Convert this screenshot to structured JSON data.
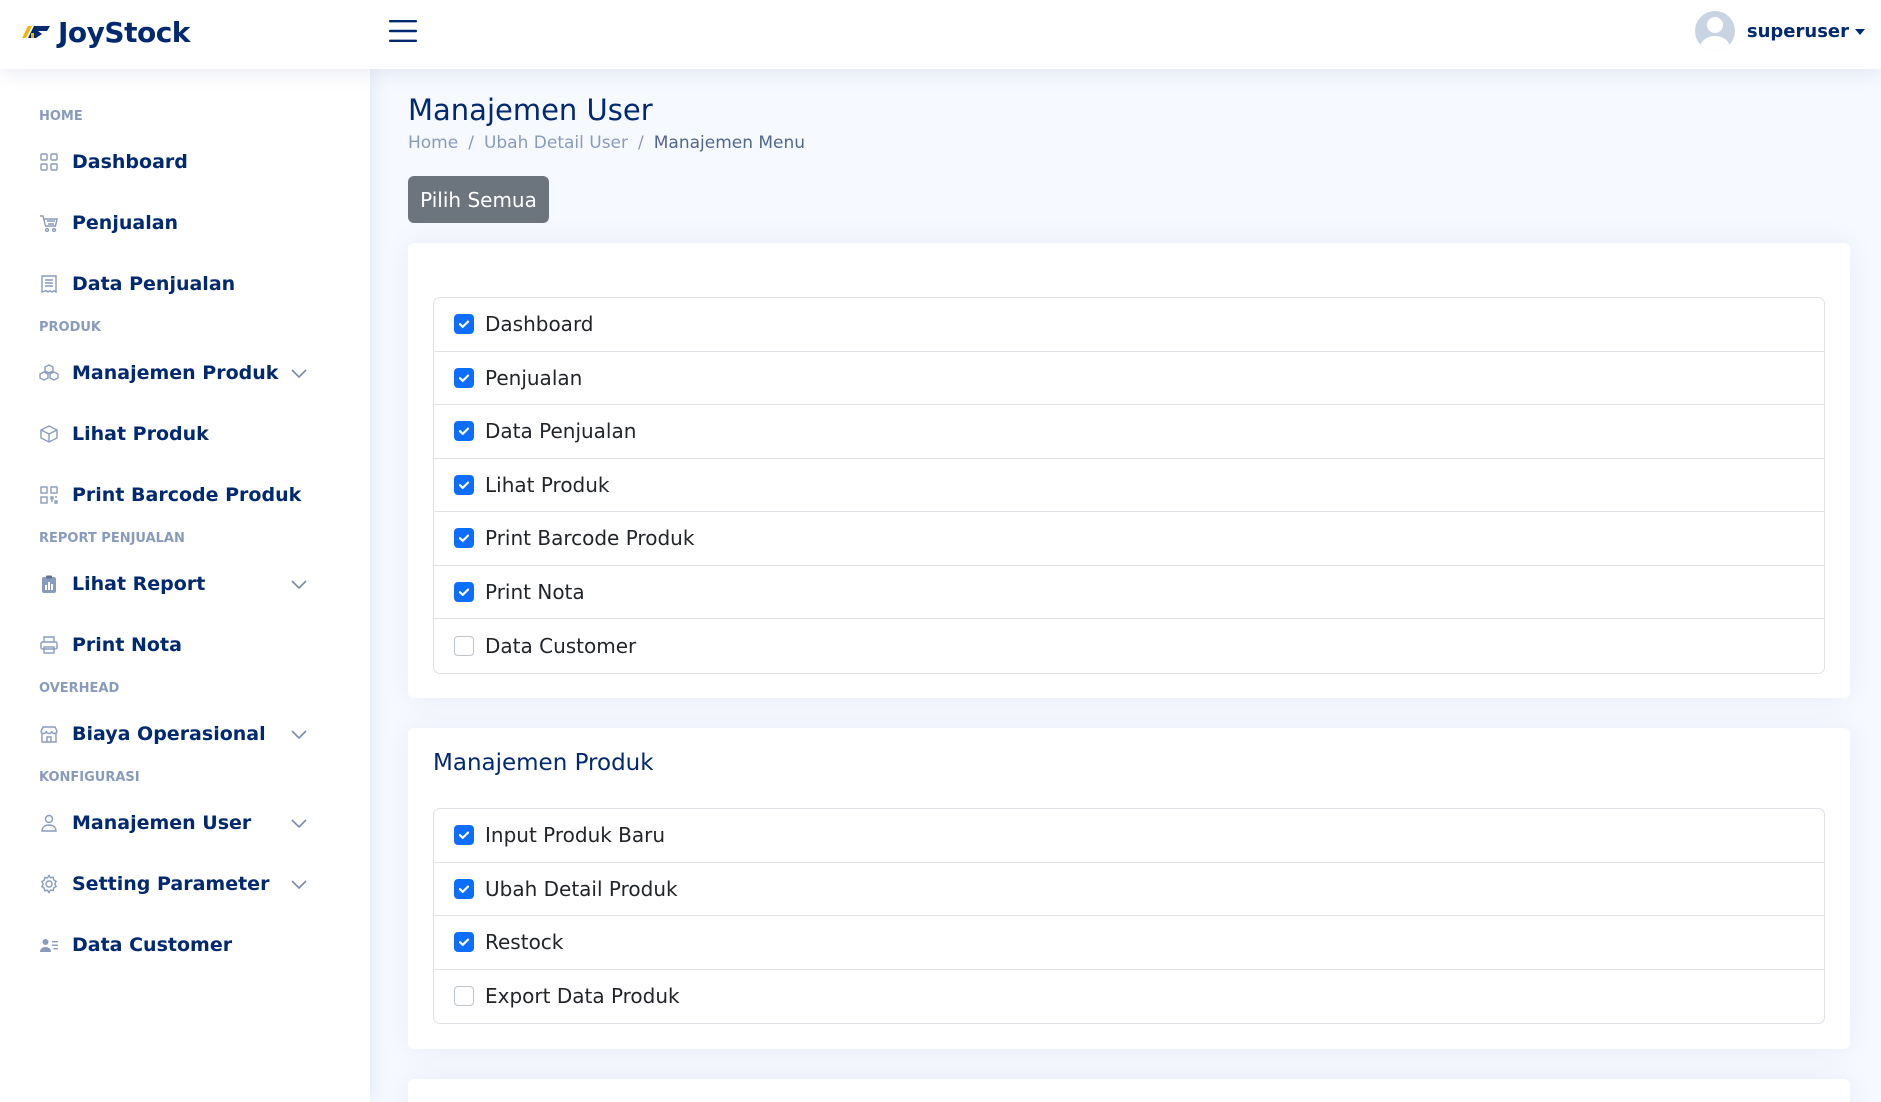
{
  "header": {
    "app_name": "JoyStock",
    "username": "superuser",
    "icons": {
      "logo": "joystock-logo-icon",
      "menu": "hamburger-menu-icon",
      "avatar": "user-avatar-icon"
    }
  },
  "sidebar": {
    "sections": [
      {
        "heading": "HOME",
        "items": [
          {
            "label": "Dashboard",
            "icon": "grid-icon",
            "expandable": false
          },
          {
            "label": "Penjualan",
            "icon": "cart-icon",
            "expandable": false
          },
          {
            "label": "Data Penjualan",
            "icon": "receipt-icon",
            "expandable": false
          }
        ]
      },
      {
        "heading": "PRODUK",
        "items": [
          {
            "label": "Manajemen Produk",
            "icon": "boxes-icon",
            "expandable": true
          },
          {
            "label": "Lihat Produk",
            "icon": "box-icon",
            "expandable": false
          },
          {
            "label": "Print Barcode Produk",
            "icon": "qr-code-icon",
            "expandable": false
          }
        ]
      },
      {
        "heading": "REPORT PENJUALAN",
        "items": [
          {
            "label": "Lihat Report",
            "icon": "clipboard-data-icon",
            "expandable": true
          },
          {
            "label": "Print Nota",
            "icon": "printer-icon",
            "expandable": false
          }
        ]
      },
      {
        "heading": "OVERHEAD",
        "items": [
          {
            "label": "Biaya Operasional",
            "icon": "shop-icon",
            "expandable": true
          }
        ]
      },
      {
        "heading": "KONFIGURASI",
        "items": [
          {
            "label": "Manajemen User",
            "icon": "person-icon",
            "expandable": true
          },
          {
            "label": "Setting Parameter",
            "icon": "gear-icon",
            "expandable": true
          },
          {
            "label": "Data Customer",
            "icon": "person-lines-icon",
            "expandable": false
          }
        ]
      }
    ]
  },
  "page": {
    "title": "Manajemen User",
    "breadcrumb": [
      "Home",
      "Ubah Detail User",
      "Manajemen Menu"
    ],
    "select_all_label": "Pilih Semua"
  },
  "cards": [
    {
      "title": "",
      "items": [
        {
          "label": "Dashboard",
          "checked": true
        },
        {
          "label": "Penjualan",
          "checked": true
        },
        {
          "label": "Data Penjualan",
          "checked": true
        },
        {
          "label": "Lihat Produk",
          "checked": true
        },
        {
          "label": "Print Barcode Produk",
          "checked": true
        },
        {
          "label": "Print Nota",
          "checked": true
        },
        {
          "label": "Data Customer",
          "checked": false
        }
      ]
    },
    {
      "title": "Manajemen Produk",
      "items": [
        {
          "label": "Input Produk Baru",
          "checked": true
        },
        {
          "label": "Ubah Detail Produk",
          "checked": true
        },
        {
          "label": "Restock",
          "checked": true
        },
        {
          "label": "Export Data Produk",
          "checked": false
        }
      ]
    }
  ],
  "colors": {
    "primary_text": "#012970",
    "checkbox_checked": "#0d6efd",
    "button_secondary": "#6c757d",
    "muted": "#899bbd"
  }
}
